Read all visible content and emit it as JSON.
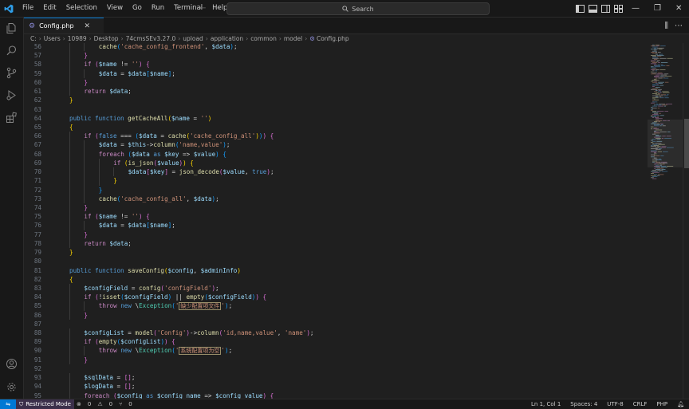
{
  "menu": [
    "File",
    "Edit",
    "Selection",
    "View",
    "Go",
    "Run",
    "Terminal",
    "Help"
  ],
  "search": {
    "label": "Search"
  },
  "tab": {
    "label": "Config.php"
  },
  "breadcrumb": [
    "C:",
    "Users",
    "10989",
    "Desktop",
    "74cmsSEv3.27.0",
    "upload",
    "application",
    "common",
    "model",
    "Config.php"
  ],
  "status": {
    "restricted": "Restricted Mode",
    "errors": "0",
    "warnings": "0",
    "ports": "0",
    "position": "Ln 1, Col 1",
    "spaces": "Spaces: 4",
    "encoding": "UTF-8",
    "eol": "CRLF",
    "language": "PHP"
  },
  "colors": {
    "accent": "#0078d4",
    "background": "#1f1f1f",
    "statusbar_restricted": "#3b2f4a"
  },
  "icons": {
    "activity": [
      "files-icon",
      "search-icon",
      "source-control-icon",
      "run-debug-icon",
      "extensions-icon",
      "account-icon",
      "settings-gear-icon"
    ]
  },
  "code": [
    {
      "n": "56",
      "indent": 2,
      "t": [
        [
          "fn",
          "cache"
        ],
        [
          "br3",
          "("
        ],
        [
          "str",
          "'cache_config_frontend'"
        ],
        [
          "op",
          ", "
        ],
        [
          "var",
          "$data"
        ],
        [
          "br3",
          ")"
        ],
        [
          "op",
          ";"
        ]
      ]
    },
    {
      "n": "57",
      "indent": 1,
      "t": [
        [
          "br2",
          "}"
        ]
      ]
    },
    {
      "n": "58",
      "indent": 1,
      "t": [
        [
          "ctl",
          "if"
        ],
        [
          "op",
          " "
        ],
        [
          "br2",
          "("
        ],
        [
          "var",
          "$name"
        ],
        [
          "op",
          " != "
        ],
        [
          "str",
          "''"
        ],
        [
          "br2",
          ")"
        ],
        [
          "op",
          " "
        ],
        [
          "br2",
          "{"
        ]
      ]
    },
    {
      "n": "59",
      "indent": 2,
      "t": [
        [
          "var",
          "$data"
        ],
        [
          "op",
          " = "
        ],
        [
          "var",
          "$data"
        ],
        [
          "br3",
          "["
        ],
        [
          "var",
          "$name"
        ],
        [
          "br3",
          "]"
        ],
        [
          "op",
          ";"
        ]
      ]
    },
    {
      "n": "60",
      "indent": 1,
      "t": [
        [
          "br2",
          "}"
        ]
      ]
    },
    {
      "n": "61",
      "indent": 1,
      "t": [
        [
          "ctl",
          "return"
        ],
        [
          "op",
          " "
        ],
        [
          "var",
          "$data"
        ],
        [
          "op",
          ";"
        ]
      ]
    },
    {
      "n": "62",
      "indent": 0,
      "t": [
        [
          "br1",
          "}"
        ]
      ]
    },
    {
      "n": "63",
      "indent": 0,
      "t": []
    },
    {
      "n": "64",
      "indent": 0,
      "t": [
        [
          "kw",
          "public"
        ],
        [
          "op",
          " "
        ],
        [
          "kw",
          "function"
        ],
        [
          "op",
          " "
        ],
        [
          "fn",
          "getCacheAll"
        ],
        [
          "br1",
          "("
        ],
        [
          "var",
          "$name"
        ],
        [
          "op",
          " = "
        ],
        [
          "str",
          "''"
        ],
        [
          "br1",
          ")"
        ]
      ]
    },
    {
      "n": "65",
      "indent": 0,
      "t": [
        [
          "br1",
          "{"
        ]
      ]
    },
    {
      "n": "66",
      "indent": 1,
      "t": [
        [
          "ctl",
          "if"
        ],
        [
          "op",
          " "
        ],
        [
          "br2",
          "("
        ],
        [
          "boolc",
          "false"
        ],
        [
          "op",
          " === "
        ],
        [
          "br3",
          "("
        ],
        [
          "var",
          "$data"
        ],
        [
          "op",
          " = "
        ],
        [
          "fn",
          "cache"
        ],
        [
          "br1",
          "("
        ],
        [
          "str",
          "'cache_config_all'"
        ],
        [
          "br1",
          ")"
        ],
        [
          "br3",
          ")"
        ],
        [
          "br2",
          ")"
        ],
        [
          "op",
          " "
        ],
        [
          "br2",
          "{"
        ]
      ]
    },
    {
      "n": "67",
      "indent": 2,
      "t": [
        [
          "var",
          "$data"
        ],
        [
          "op",
          " = "
        ],
        [
          "var",
          "$this"
        ],
        [
          "op",
          "->"
        ],
        [
          "fn",
          "column"
        ],
        [
          "br3",
          "("
        ],
        [
          "str",
          "'name,value'"
        ],
        [
          "br3",
          ")"
        ],
        [
          "op",
          ";"
        ]
      ]
    },
    {
      "n": "68",
      "indent": 2,
      "t": [
        [
          "ctl",
          "foreach"
        ],
        [
          "op",
          " "
        ],
        [
          "br3",
          "("
        ],
        [
          "var",
          "$data"
        ],
        [
          "op",
          " "
        ],
        [
          "kw",
          "as"
        ],
        [
          "op",
          " "
        ],
        [
          "var",
          "$key"
        ],
        [
          "op",
          " => "
        ],
        [
          "var",
          "$value"
        ],
        [
          "br3",
          ")"
        ],
        [
          "op",
          " "
        ],
        [
          "br3",
          "{"
        ]
      ]
    },
    {
      "n": "69",
      "indent": 3,
      "t": [
        [
          "ctl",
          "if"
        ],
        [
          "op",
          " "
        ],
        [
          "br1",
          "("
        ],
        [
          "fn",
          "is_json"
        ],
        [
          "br2",
          "("
        ],
        [
          "var",
          "$value"
        ],
        [
          "br2",
          ")"
        ],
        [
          "br1",
          ")"
        ],
        [
          "op",
          " "
        ],
        [
          "br1",
          "{"
        ]
      ]
    },
    {
      "n": "70",
      "indent": 4,
      "t": [
        [
          "var",
          "$data"
        ],
        [
          "br2",
          "["
        ],
        [
          "var",
          "$key"
        ],
        [
          "br2",
          "]"
        ],
        [
          "op",
          " = "
        ],
        [
          "fn",
          "json_decode"
        ],
        [
          "br2",
          "("
        ],
        [
          "var",
          "$value"
        ],
        [
          "op",
          ", "
        ],
        [
          "boolc",
          "true"
        ],
        [
          "br2",
          ")"
        ],
        [
          "op",
          ";"
        ]
      ]
    },
    {
      "n": "71",
      "indent": 3,
      "t": [
        [
          "br1",
          "}"
        ]
      ]
    },
    {
      "n": "72",
      "indent": 2,
      "t": [
        [
          "br3",
          "}"
        ]
      ]
    },
    {
      "n": "73",
      "indent": 2,
      "t": [
        [
          "fn",
          "cache"
        ],
        [
          "br3",
          "("
        ],
        [
          "str",
          "'cache_config_all'"
        ],
        [
          "op",
          ", "
        ],
        [
          "var",
          "$data"
        ],
        [
          "br3",
          ")"
        ],
        [
          "op",
          ";"
        ]
      ]
    },
    {
      "n": "74",
      "indent": 1,
      "t": [
        [
          "br2",
          "}"
        ]
      ]
    },
    {
      "n": "75",
      "indent": 1,
      "t": [
        [
          "ctl",
          "if"
        ],
        [
          "op",
          " "
        ],
        [
          "br2",
          "("
        ],
        [
          "var",
          "$name"
        ],
        [
          "op",
          " != "
        ],
        [
          "str",
          "''"
        ],
        [
          "br2",
          ")"
        ],
        [
          "op",
          " "
        ],
        [
          "br2",
          "{"
        ]
      ]
    },
    {
      "n": "76",
      "indent": 2,
      "t": [
        [
          "var",
          "$data"
        ],
        [
          "op",
          " = "
        ],
        [
          "var",
          "$data"
        ],
        [
          "br3",
          "["
        ],
        [
          "var",
          "$name"
        ],
        [
          "br3",
          "]"
        ],
        [
          "op",
          ";"
        ]
      ]
    },
    {
      "n": "77",
      "indent": 1,
      "t": [
        [
          "br2",
          "}"
        ]
      ]
    },
    {
      "n": "78",
      "indent": 1,
      "t": [
        [
          "ctl",
          "return"
        ],
        [
          "op",
          " "
        ],
        [
          "var",
          "$data"
        ],
        [
          "op",
          ";"
        ]
      ]
    },
    {
      "n": "79",
      "indent": 0,
      "t": [
        [
          "br1",
          "}"
        ]
      ]
    },
    {
      "n": "80",
      "indent": 0,
      "t": []
    },
    {
      "n": "81",
      "indent": 0,
      "t": [
        [
          "kw",
          "public"
        ],
        [
          "op",
          " "
        ],
        [
          "kw",
          "function"
        ],
        [
          "op",
          " "
        ],
        [
          "fn",
          "saveConfig"
        ],
        [
          "br1",
          "("
        ],
        [
          "var",
          "$config"
        ],
        [
          "op",
          ", "
        ],
        [
          "var",
          "$adminInfo"
        ],
        [
          "br1",
          ")"
        ]
      ]
    },
    {
      "n": "82",
      "indent": 0,
      "t": [
        [
          "br1",
          "{"
        ]
      ]
    },
    {
      "n": "83",
      "indent": 1,
      "t": [
        [
          "var",
          "$configField"
        ],
        [
          "op",
          " = "
        ],
        [
          "fn",
          "config"
        ],
        [
          "br2",
          "("
        ],
        [
          "str",
          "'configField'"
        ],
        [
          "br2",
          ")"
        ],
        [
          "op",
          ";"
        ]
      ]
    },
    {
      "n": "84",
      "indent": 1,
      "t": [
        [
          "ctl",
          "if"
        ],
        [
          "op",
          " "
        ],
        [
          "br2",
          "("
        ],
        [
          "op",
          "!"
        ],
        [
          "fn",
          "isset"
        ],
        [
          "br3",
          "("
        ],
        [
          "var",
          "$configField"
        ],
        [
          "br3",
          ")"
        ],
        [
          "op",
          " || "
        ],
        [
          "fn",
          "empty"
        ],
        [
          "br3",
          "("
        ],
        [
          "var",
          "$configField"
        ],
        [
          "br3",
          ")"
        ],
        [
          "br2",
          ")"
        ],
        [
          "op",
          " "
        ],
        [
          "br2",
          "{"
        ]
      ]
    },
    {
      "n": "85",
      "indent": 2,
      "t": [
        [
          "ctl",
          "throw"
        ],
        [
          "op",
          " "
        ],
        [
          "kw",
          "new"
        ],
        [
          "op",
          " \\"
        ],
        [
          "cls",
          "Exception"
        ],
        [
          "br3",
          "("
        ],
        [
          "str",
          "'"
        ],
        [
          "cjk",
          "缺少配置项文件"
        ],
        [
          "str",
          "'"
        ],
        [
          "br3",
          ")"
        ],
        [
          "op",
          ";"
        ]
      ]
    },
    {
      "n": "86",
      "indent": 1,
      "t": [
        [
          "br2",
          "}"
        ]
      ]
    },
    {
      "n": "87",
      "indent": 0,
      "t": []
    },
    {
      "n": "88",
      "indent": 1,
      "t": [
        [
          "var",
          "$configList"
        ],
        [
          "op",
          " = "
        ],
        [
          "fn",
          "model"
        ],
        [
          "br2",
          "("
        ],
        [
          "str",
          "'Config'"
        ],
        [
          "br2",
          ")"
        ],
        [
          "op",
          "->"
        ],
        [
          "fn",
          "column"
        ],
        [
          "br2",
          "("
        ],
        [
          "str",
          "'id,name,value'"
        ],
        [
          "op",
          ", "
        ],
        [
          "str",
          "'name'"
        ],
        [
          "br2",
          ")"
        ],
        [
          "op",
          ";"
        ]
      ]
    },
    {
      "n": "89",
      "indent": 1,
      "t": [
        [
          "ctl",
          "if"
        ],
        [
          "op",
          " "
        ],
        [
          "br2",
          "("
        ],
        [
          "fn",
          "empty"
        ],
        [
          "br3",
          "("
        ],
        [
          "var",
          "$configList"
        ],
        [
          "br3",
          ")"
        ],
        [
          "br2",
          ")"
        ],
        [
          "op",
          " "
        ],
        [
          "br2",
          "{"
        ]
      ]
    },
    {
      "n": "90",
      "indent": 2,
      "t": [
        [
          "ctl",
          "throw"
        ],
        [
          "op",
          " "
        ],
        [
          "kw",
          "new"
        ],
        [
          "op",
          " \\"
        ],
        [
          "cls",
          "Exception"
        ],
        [
          "br3",
          "("
        ],
        [
          "str",
          "'"
        ],
        [
          "cjk",
          "系统配置项为空"
        ],
        [
          "str",
          "'"
        ],
        [
          "br3",
          ")"
        ],
        [
          "op",
          ";"
        ]
      ]
    },
    {
      "n": "91",
      "indent": 1,
      "t": [
        [
          "br2",
          "}"
        ]
      ]
    },
    {
      "n": "92",
      "indent": 0,
      "t": []
    },
    {
      "n": "93",
      "indent": 1,
      "t": [
        [
          "var",
          "$sqlData"
        ],
        [
          "op",
          " = "
        ],
        [
          "br2",
          "[]"
        ],
        [
          "op",
          ";"
        ]
      ]
    },
    {
      "n": "94",
      "indent": 1,
      "t": [
        [
          "var",
          "$logData"
        ],
        [
          "op",
          " = "
        ],
        [
          "br2",
          "[]"
        ],
        [
          "op",
          ";"
        ]
      ]
    },
    {
      "n": "95",
      "indent": 1,
      "t": [
        [
          "ctl",
          "foreach"
        ],
        [
          "op",
          " "
        ],
        [
          "br2",
          "("
        ],
        [
          "var",
          "$config"
        ],
        [
          "op",
          " "
        ],
        [
          "kw",
          "as"
        ],
        [
          "op",
          " "
        ],
        [
          "var",
          "$config_name"
        ],
        [
          "op",
          " => "
        ],
        [
          "var",
          "$config_value"
        ],
        [
          "br2",
          ")"
        ],
        [
          "op",
          " "
        ],
        [
          "br2",
          "{"
        ]
      ]
    }
  ]
}
